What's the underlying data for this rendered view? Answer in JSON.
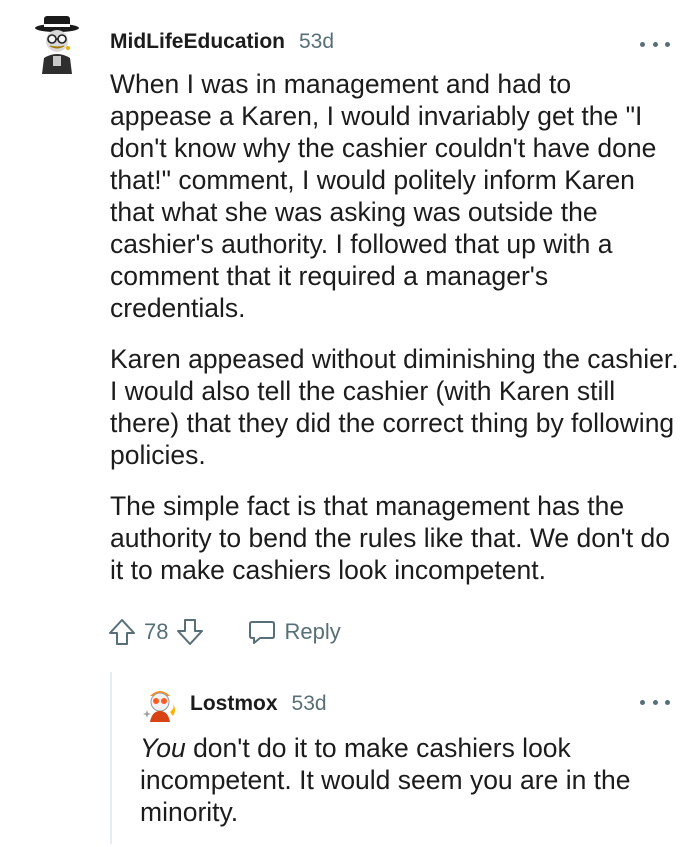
{
  "comments": [
    {
      "username": "MidLifeEducation",
      "age": "53d",
      "avatar": "avatar-icon",
      "paragraphs": [
        "When I was in management and had to appease a Karen, I would invariably get the \"I don't know why the cashier couldn't have done that!\" comment, I would politely inform Karen that what she was asking was outside the cashier's authority. I followed that up with a comment that it required a manager's credentials.",
        "Karen appeased without diminishing the cashier. I would also tell the cashier (with Karen still there) that they did the correct thing by following policies.",
        "The simple fact is that management has the authority to bend the rules like that. We don't do it to make cashiers look incompetent."
      ],
      "score": "78",
      "reply_label": "Reply"
    },
    {
      "username": "Lostmox",
      "age": "53d",
      "avatar": "avatar-icon",
      "emphasis": "You",
      "text": " don't do it to make cashiers look incompetent. It would seem you are in the minority."
    }
  ],
  "colors": {
    "text": "#1c1c1c",
    "meta": "#576f76",
    "thread_line": "#e5ebee"
  }
}
